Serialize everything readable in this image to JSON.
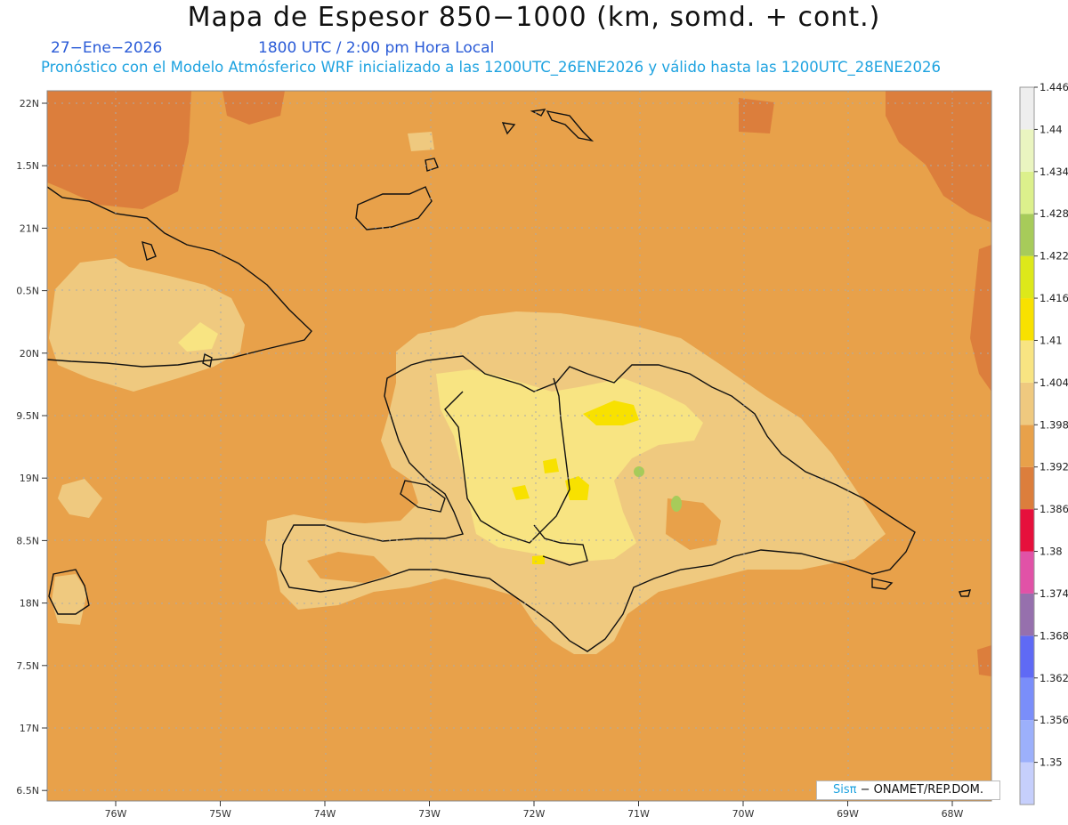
{
  "header": {
    "title": "Mapa de Espesor 850−1000 (km, somd. + cont.)",
    "date": "27−Ene−2026",
    "valid_time": "1800 UTC / 2:00 pm Hora Local",
    "forecast_info": "Pronóstico con el Modelo Atmósferico WRF inicializado a las 1200UTC_26ENE2026 y válido hasta las  1200UTC_28ENE2026"
  },
  "credit": {
    "brand": "Sisπ",
    "rest": " − ONAMET/REP.DOM."
  },
  "axes": {
    "lat_labels": [
      "22N",
      "1.5N",
      "21N",
      "0.5N",
      "20N",
      "9.5N",
      "19N",
      "8.5N",
      "18N",
      "7.5N",
      "17N",
      "6.5N"
    ],
    "lon_labels": [
      "76W",
      "75W",
      "74W",
      "73W",
      "72W",
      "71W",
      "70W",
      "69W",
      "68W"
    ]
  },
  "colorbar": {
    "levels": [
      "1.35",
      "1.356",
      "1.362",
      "1.368",
      "1.374",
      "1.38",
      "1.386",
      "1.392",
      "1.398",
      "1.404",
      "1.41",
      "1.416",
      "1.422",
      "1.428",
      "1.434",
      "1.44",
      "1.446"
    ],
    "colors": [
      "#c6cffc",
      "#9cb0fb",
      "#7a8efa",
      "#5f6af5",
      "#9670ad",
      "#e152a7",
      "#e6103c",
      "#dc7e3c",
      "#e8a14a",
      "#efc97f",
      "#f8e482",
      "#f8e100",
      "#dde81a",
      "#a7cb5a",
      "#dcf08c",
      "#eaf5c0",
      "#eeeeee"
    ]
  },
  "map": {
    "background_color": "#e8a14a",
    "field_colors": {
      "cool": "#dc7e3c",
      "warm": "#efc97f",
      "warmer": "#f8e482",
      "warmest": "#f8e100"
    }
  }
}
